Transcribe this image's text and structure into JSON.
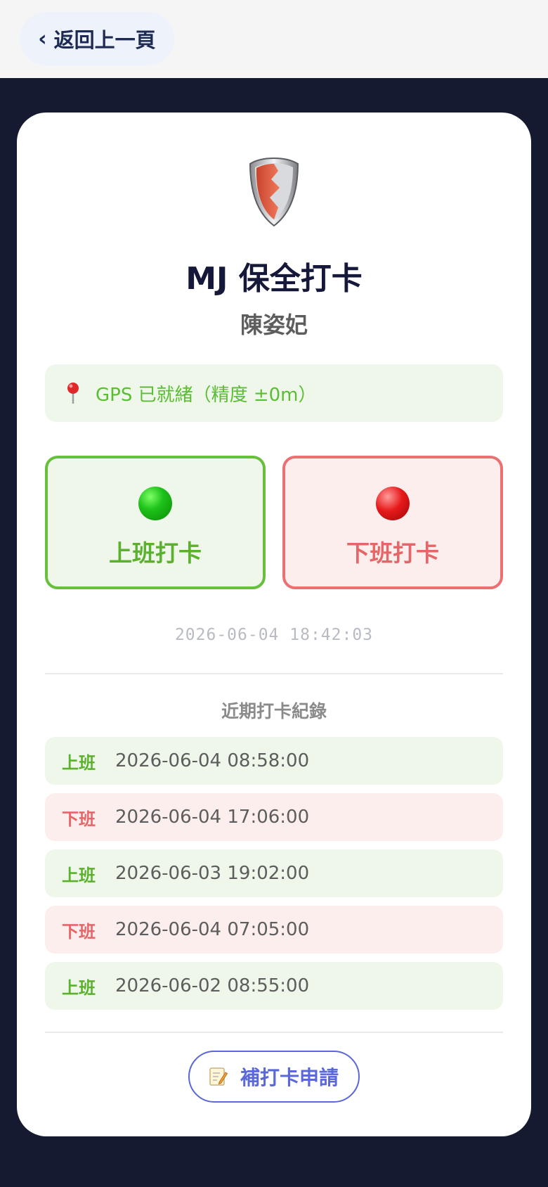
{
  "header": {
    "back_label": "返回上一頁",
    "back_icon": "chevron-left-icon"
  },
  "card": {
    "title": "MJ 保全打卡",
    "user_name": "陳姿妃",
    "logo_icon": "shield-icon"
  },
  "gps": {
    "icon": "map-pin-icon",
    "status_text": "GPS 已就緒（精度 ±0m）"
  },
  "actions": {
    "clock_in_label": "上班打卡",
    "clock_out_label": "下班打卡",
    "clock_in_icon": "green-circle-icon",
    "clock_out_icon": "red-circle-icon"
  },
  "current_time": "2026-06-04 18:42:03",
  "records": {
    "title": "近期打卡紀錄",
    "items": [
      {
        "type": "上班",
        "kind": "in",
        "time": "2026-06-04 08:58:00"
      },
      {
        "type": "下班",
        "kind": "out",
        "time": "2026-06-04 17:06:00"
      },
      {
        "type": "上班",
        "kind": "in",
        "time": "2026-06-03 19:02:00"
      },
      {
        "type": "下班",
        "kind": "out",
        "time": "2026-06-04 07:05:00"
      },
      {
        "type": "上班",
        "kind": "in",
        "time": "2026-06-02 08:55:00"
      }
    ]
  },
  "supplement": {
    "label": "補打卡申請",
    "icon": "memo-icon"
  },
  "colors": {
    "background": "#161a31",
    "clock_in_green": "#67bf3c",
    "clock_out_red": "#ec6f72",
    "accent_blue": "#5a68d8"
  }
}
